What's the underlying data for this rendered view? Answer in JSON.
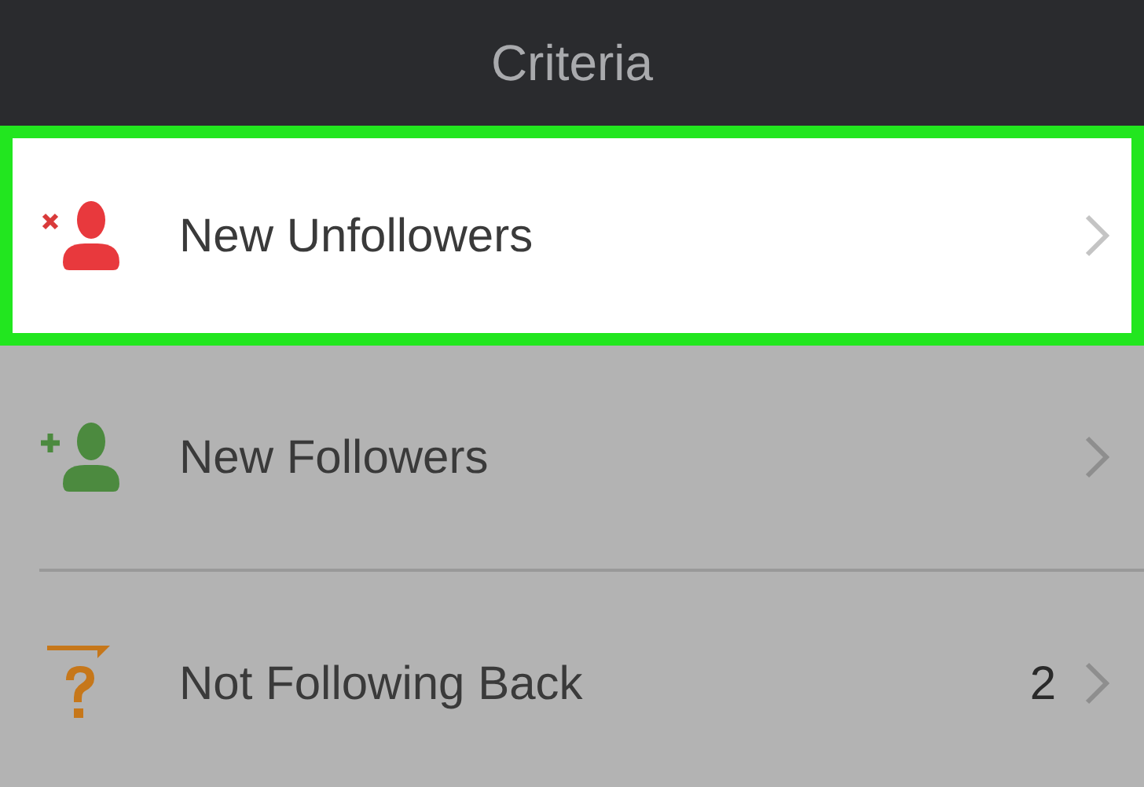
{
  "header": {
    "title": "Criteria"
  },
  "rows": [
    {
      "kind": "unfollower",
      "label": "New Unfollowers",
      "highlighted": true
    },
    {
      "kind": "follower",
      "label": "New Followers",
      "highlighted": false
    },
    {
      "kind": "not-following-back",
      "label": "Not Following Back",
      "count": "2",
      "highlighted": false
    }
  ]
}
